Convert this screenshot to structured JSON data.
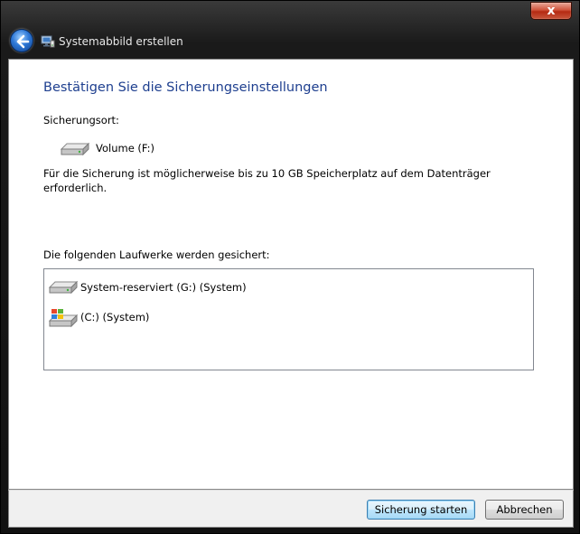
{
  "window": {
    "title": "Systemabbild erstellen",
    "close_label": "x"
  },
  "content": {
    "heading": "Bestätigen Sie die Sicherungseinstellungen",
    "location_label": "Sicherungsort:",
    "location_drive": "Volume (F:)",
    "info_text": "Für die Sicherung ist möglicherweise bis zu 10 GB Speicherplatz auf dem Datenträger erforderlich.",
    "drives_label": "Die folgenden Laufwerke werden gesichert:",
    "drives": [
      {
        "label": "System-reserviert (G:) (System)",
        "icon": "hard-drive-icon"
      },
      {
        "label": "(C:) (System)",
        "icon": "windows-drive-icon"
      }
    ]
  },
  "buttons": {
    "start": "Sicherung starten",
    "cancel": "Abbrechen"
  },
  "colors": {
    "heading": "#1e3f8f",
    "frame": "#111111",
    "close": "#c9563c"
  }
}
